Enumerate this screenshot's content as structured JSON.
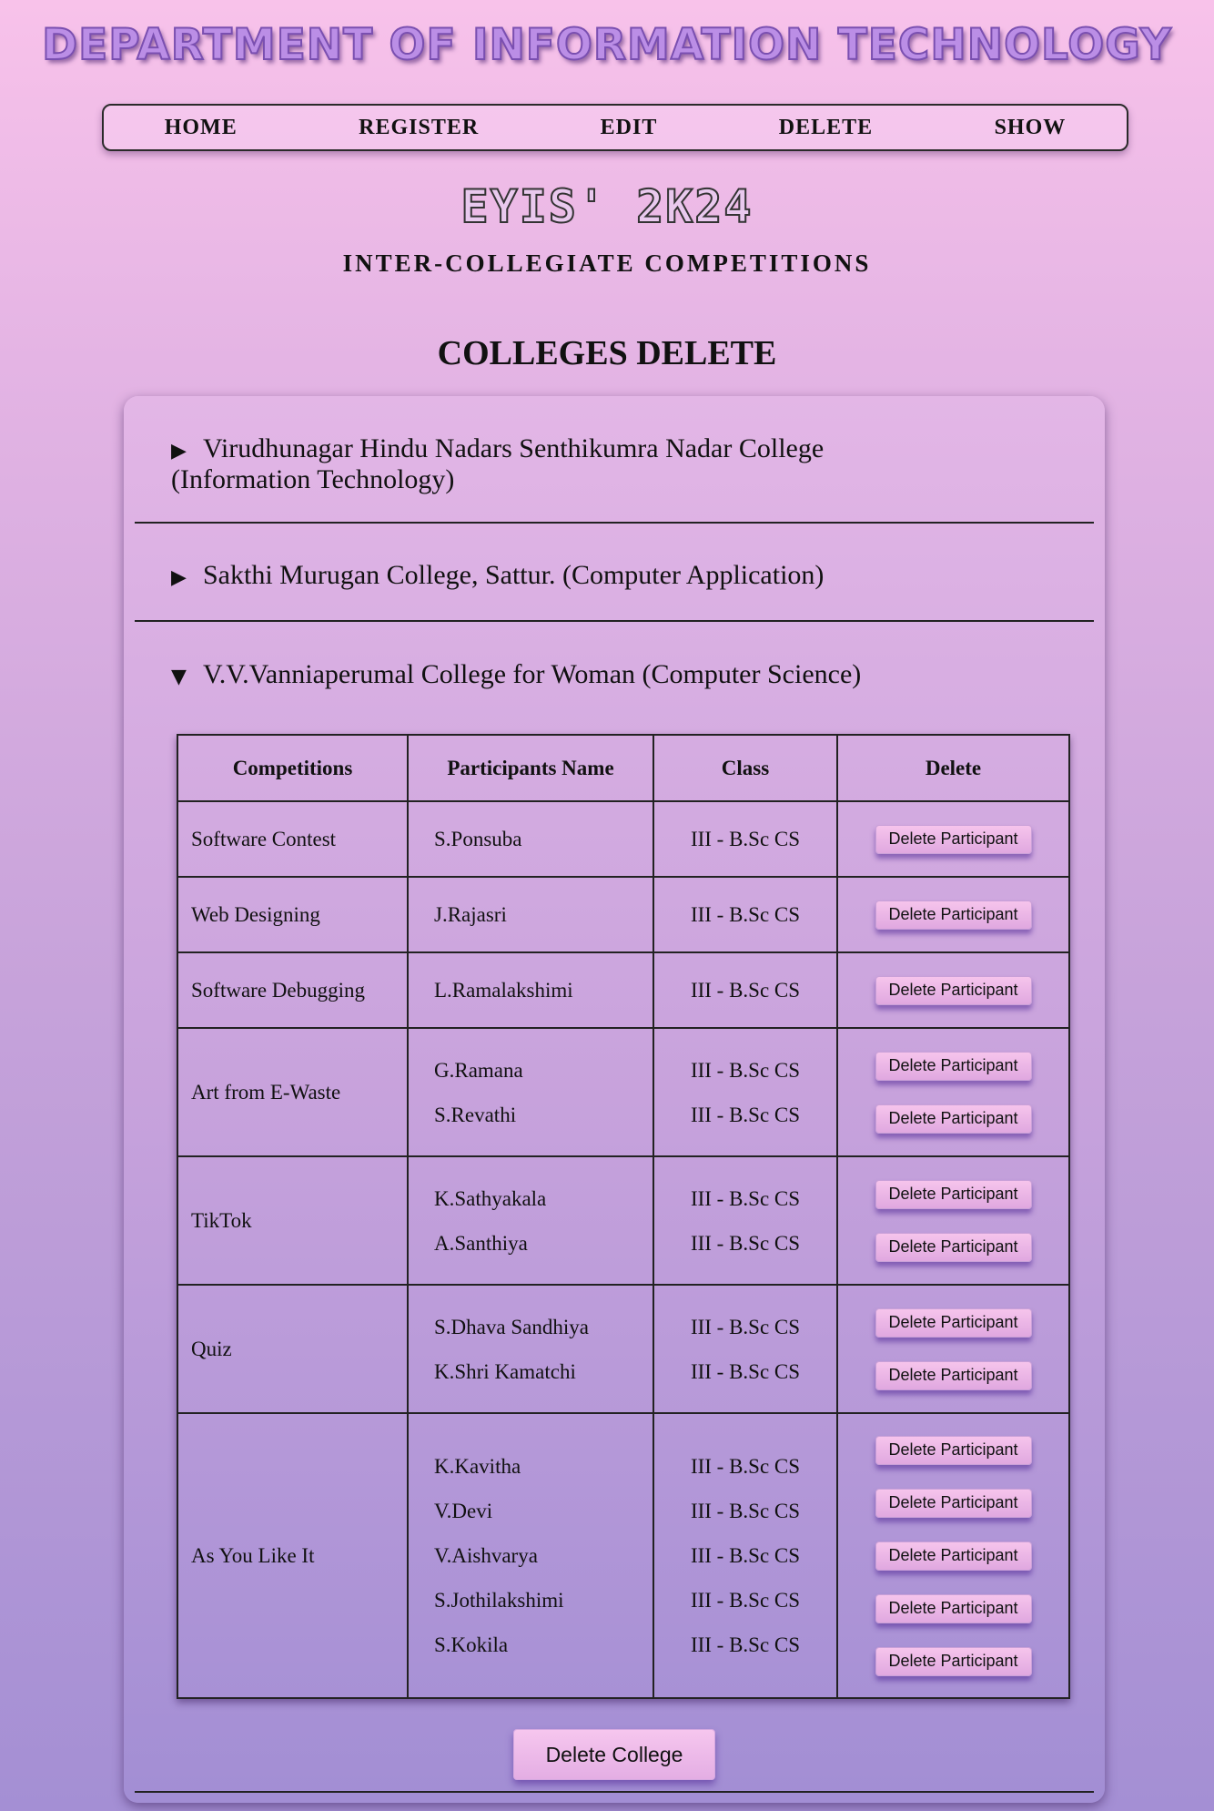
{
  "header": {
    "site_title": "DEPARTMENT OF INFORMATION TECHNOLOGY",
    "nav": [
      "HOME",
      "REGISTER",
      "EDIT",
      "DELETE",
      "SHOW"
    ],
    "event_title": "EYIS' 2K24",
    "event_subtitle": "INTER-COLLEGIATE COMPETITIONS"
  },
  "page_heading": "COLLEGES DELETE",
  "colleges": [
    {
      "name": "Virudhunagar Hindu Nadars Senthikumra Nadar College",
      "dept": "(Information Technology)",
      "expanded": false,
      "arrow": "▶"
    },
    {
      "name": "Sakthi Murugan College, Sattur. (Computer Application)",
      "expanded": false,
      "arrow": "▶"
    },
    {
      "name": "V.V.Vanniaperumal College for Woman (Computer Science)",
      "expanded": true,
      "arrow": "▼"
    }
  ],
  "table": {
    "headers": [
      "Competitions",
      "Participants Name",
      "Class",
      "Delete"
    ],
    "rows": [
      {
        "competition": "Software Contest",
        "participants": [
          {
            "name": "S.Ponsuba",
            "class": "III - B.Sc CS"
          }
        ]
      },
      {
        "competition": "Web Designing",
        "participants": [
          {
            "name": "J.Rajasri",
            "class": "III - B.Sc CS"
          }
        ]
      },
      {
        "competition": "Software Debugging",
        "participants": [
          {
            "name": "L.Ramalakshimi",
            "class": "III - B.Sc CS"
          }
        ]
      },
      {
        "competition": "Art from E-Waste",
        "participants": [
          {
            "name": "G.Ramana",
            "class": "III - B.Sc CS"
          },
          {
            "name": "S.Revathi",
            "class": "III - B.Sc CS"
          }
        ]
      },
      {
        "competition": "TikTok",
        "participants": [
          {
            "name": "K.Sathyakala",
            "class": "III - B.Sc CS"
          },
          {
            "name": "A.Santhiya",
            "class": "III - B.Sc CS"
          }
        ]
      },
      {
        "competition": "Quiz",
        "participants": [
          {
            "name": "S.Dhava Sandhiya",
            "class": "III - B.Sc CS"
          },
          {
            "name": "K.Shri Kamatchi",
            "class": "III - B.Sc CS"
          }
        ]
      },
      {
        "competition": "As You Like It",
        "participants": [
          {
            "name": "K.Kavitha",
            "class": "III - B.Sc CS"
          },
          {
            "name": "V.Devi",
            "class": "III - B.Sc CS"
          },
          {
            "name": "V.Aishvarya",
            "class": "III - B.Sc CS"
          },
          {
            "name": "S.Jothilakshimi",
            "class": "III - B.Sc CS"
          },
          {
            "name": "S.Kokila",
            "class": "III - B.Sc CS"
          }
        ]
      }
    ],
    "delete_participant_label": "Delete Participant"
  },
  "delete_college_label": "Delete College"
}
